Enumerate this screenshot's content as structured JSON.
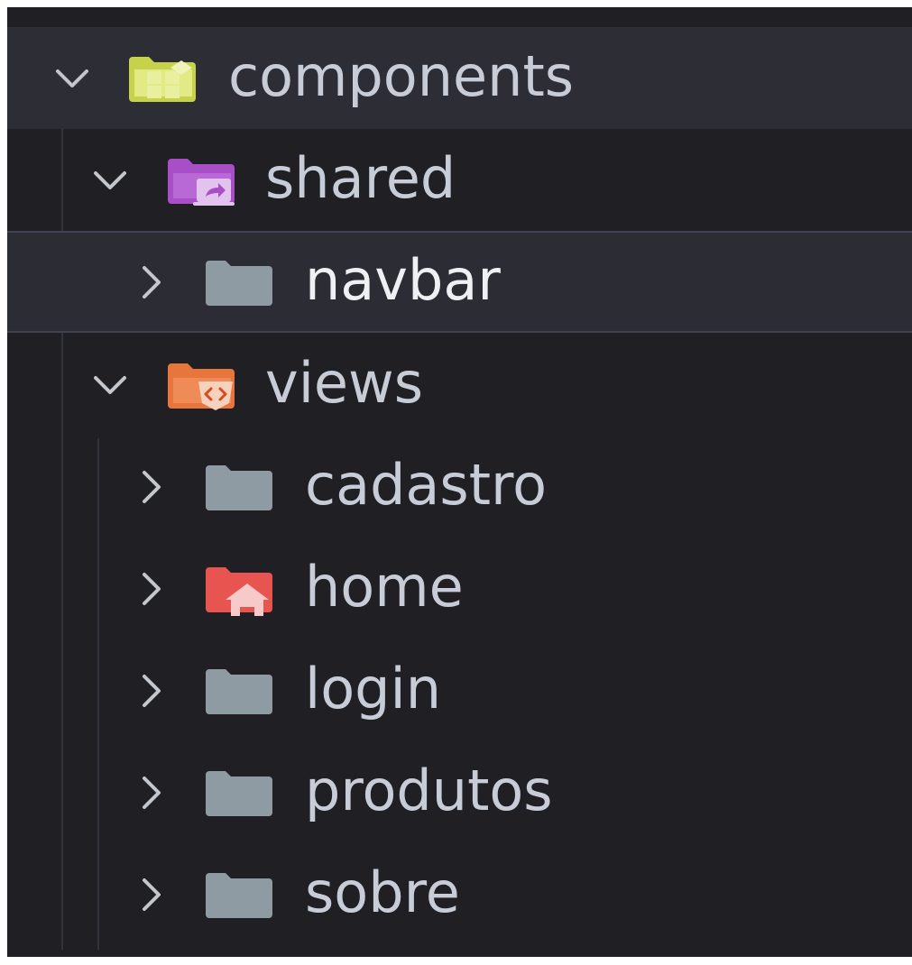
{
  "explorer": {
    "items": [
      {
        "id": "components",
        "label": "components",
        "expanded": true,
        "icon": "components-folder-icon",
        "color": "#c5d24a"
      },
      {
        "id": "shared",
        "label": "shared",
        "expanded": true,
        "icon": "shared-folder-icon",
        "color": "#a84fc8"
      },
      {
        "id": "navbar",
        "label": "navbar",
        "expanded": false,
        "icon": "folder-icon",
        "color": "#8f9ba3",
        "selected": true
      },
      {
        "id": "views",
        "label": "views",
        "expanded": true,
        "icon": "views-folder-icon",
        "color": "#e8763c"
      },
      {
        "id": "cadastro",
        "label": "cadastro",
        "expanded": false,
        "icon": "folder-icon",
        "color": "#8f9ba3"
      },
      {
        "id": "home",
        "label": "home",
        "expanded": false,
        "icon": "home-folder-icon",
        "color": "#e85450"
      },
      {
        "id": "login",
        "label": "login",
        "expanded": false,
        "icon": "folder-icon",
        "color": "#8f9ba3"
      },
      {
        "id": "produtos",
        "label": "produtos",
        "expanded": false,
        "icon": "folder-icon",
        "color": "#8f9ba3"
      },
      {
        "id": "sobre",
        "label": "sobre",
        "expanded": false,
        "icon": "folder-icon",
        "color": "#8f9ba3"
      }
    ]
  },
  "colors": {
    "background": "#1f1f24",
    "hover_row": "#2c2d35",
    "selected_row": "#2b2c34",
    "label": "#c7ccd6",
    "chevron": "#c3c6cc"
  }
}
